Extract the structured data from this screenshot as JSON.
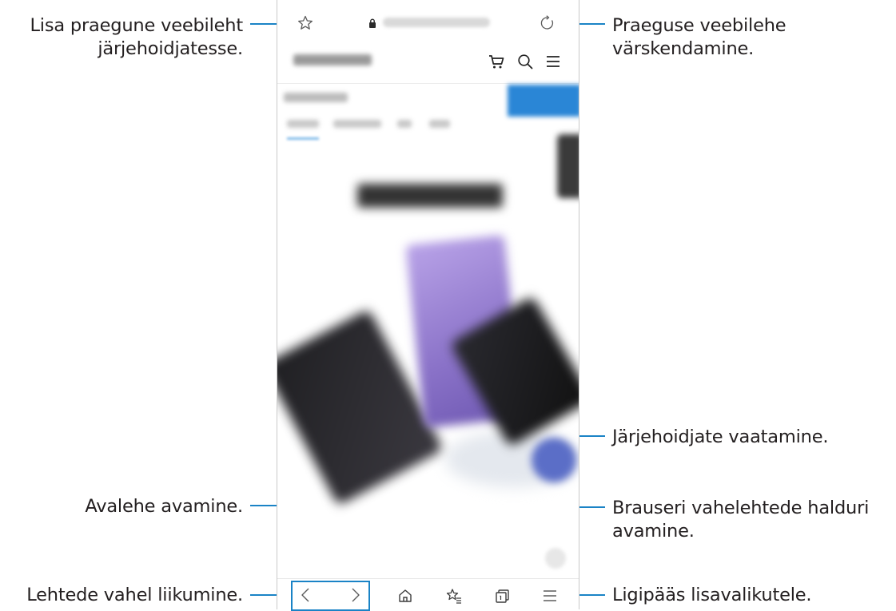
{
  "callouts": {
    "add_bookmark": "Lisa praegune veebileht\njärjehoidjatesse.",
    "refresh": "Praeguse veebilehe\nvärskendamine.",
    "view_bookmarks": "Järjehoidjate vaatamine.",
    "home": "Avalehe avamine.",
    "tabs_manager": "Brauseri vahelehtede halduri\navamine.",
    "navigate": "Lehtede vahel liikumine.",
    "more_options": "Ligipääs lisavalikutele."
  },
  "browser": {
    "icons": [
      "star-icon",
      "lock-icon",
      "reload-icon",
      "cart-icon",
      "search-icon",
      "menu-icon",
      "back-icon",
      "forward-icon",
      "home-icon",
      "bookmarks-icon",
      "tabs-icon",
      "more-icon"
    ]
  },
  "colors": {
    "accent": "#1a83c6",
    "icon": "#3c3c3c",
    "frame": "#c9c9c9"
  }
}
